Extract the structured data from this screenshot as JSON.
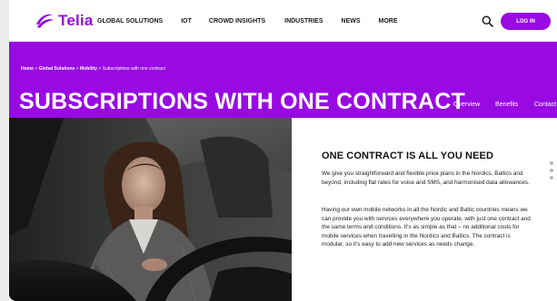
{
  "brand": {
    "name": "Telia",
    "color": "#990ae3",
    "logo_icon": "telia-pebble-logo"
  },
  "nav": {
    "items": [
      "GLOBAL SOLUTIONS",
      "IOT",
      "CROWD INSIGHTS",
      "INDUSTRIES",
      "NEWS",
      "MORE"
    ],
    "search_icon": "search-icon",
    "login_label": "LOG IN"
  },
  "breadcrumb": {
    "home": "Home",
    "sep": ">",
    "level1": "Global Solutions",
    "level2": "Mobility",
    "current": "Subscriptions with one contract"
  },
  "hero": {
    "title": "SUBSCRIPTIONS WITH ONE CONTRACT",
    "subnav": [
      "Overview",
      "Benefits",
      "Contact"
    ]
  },
  "content": {
    "heading": "ONE CONTRACT IS ALL YOU NEED",
    "paragraph1": "We give you straightforward and flexible price plans in the Nordics, Baltics and beyond, including flat rates for voice and SMS, and harmonised data allowances.",
    "paragraph2": "Having our own mobile networks in all the Nordic and Baltic countries means we can provide you with services everywhere you operate, with just one contract and the same terms and conditions. It's as simple as that – no additional costs for mobile services when travelling in the Nordics and Baltics. The contract is modular, so it's easy to add new services as needs change."
  },
  "pager": {
    "dots": 3
  }
}
